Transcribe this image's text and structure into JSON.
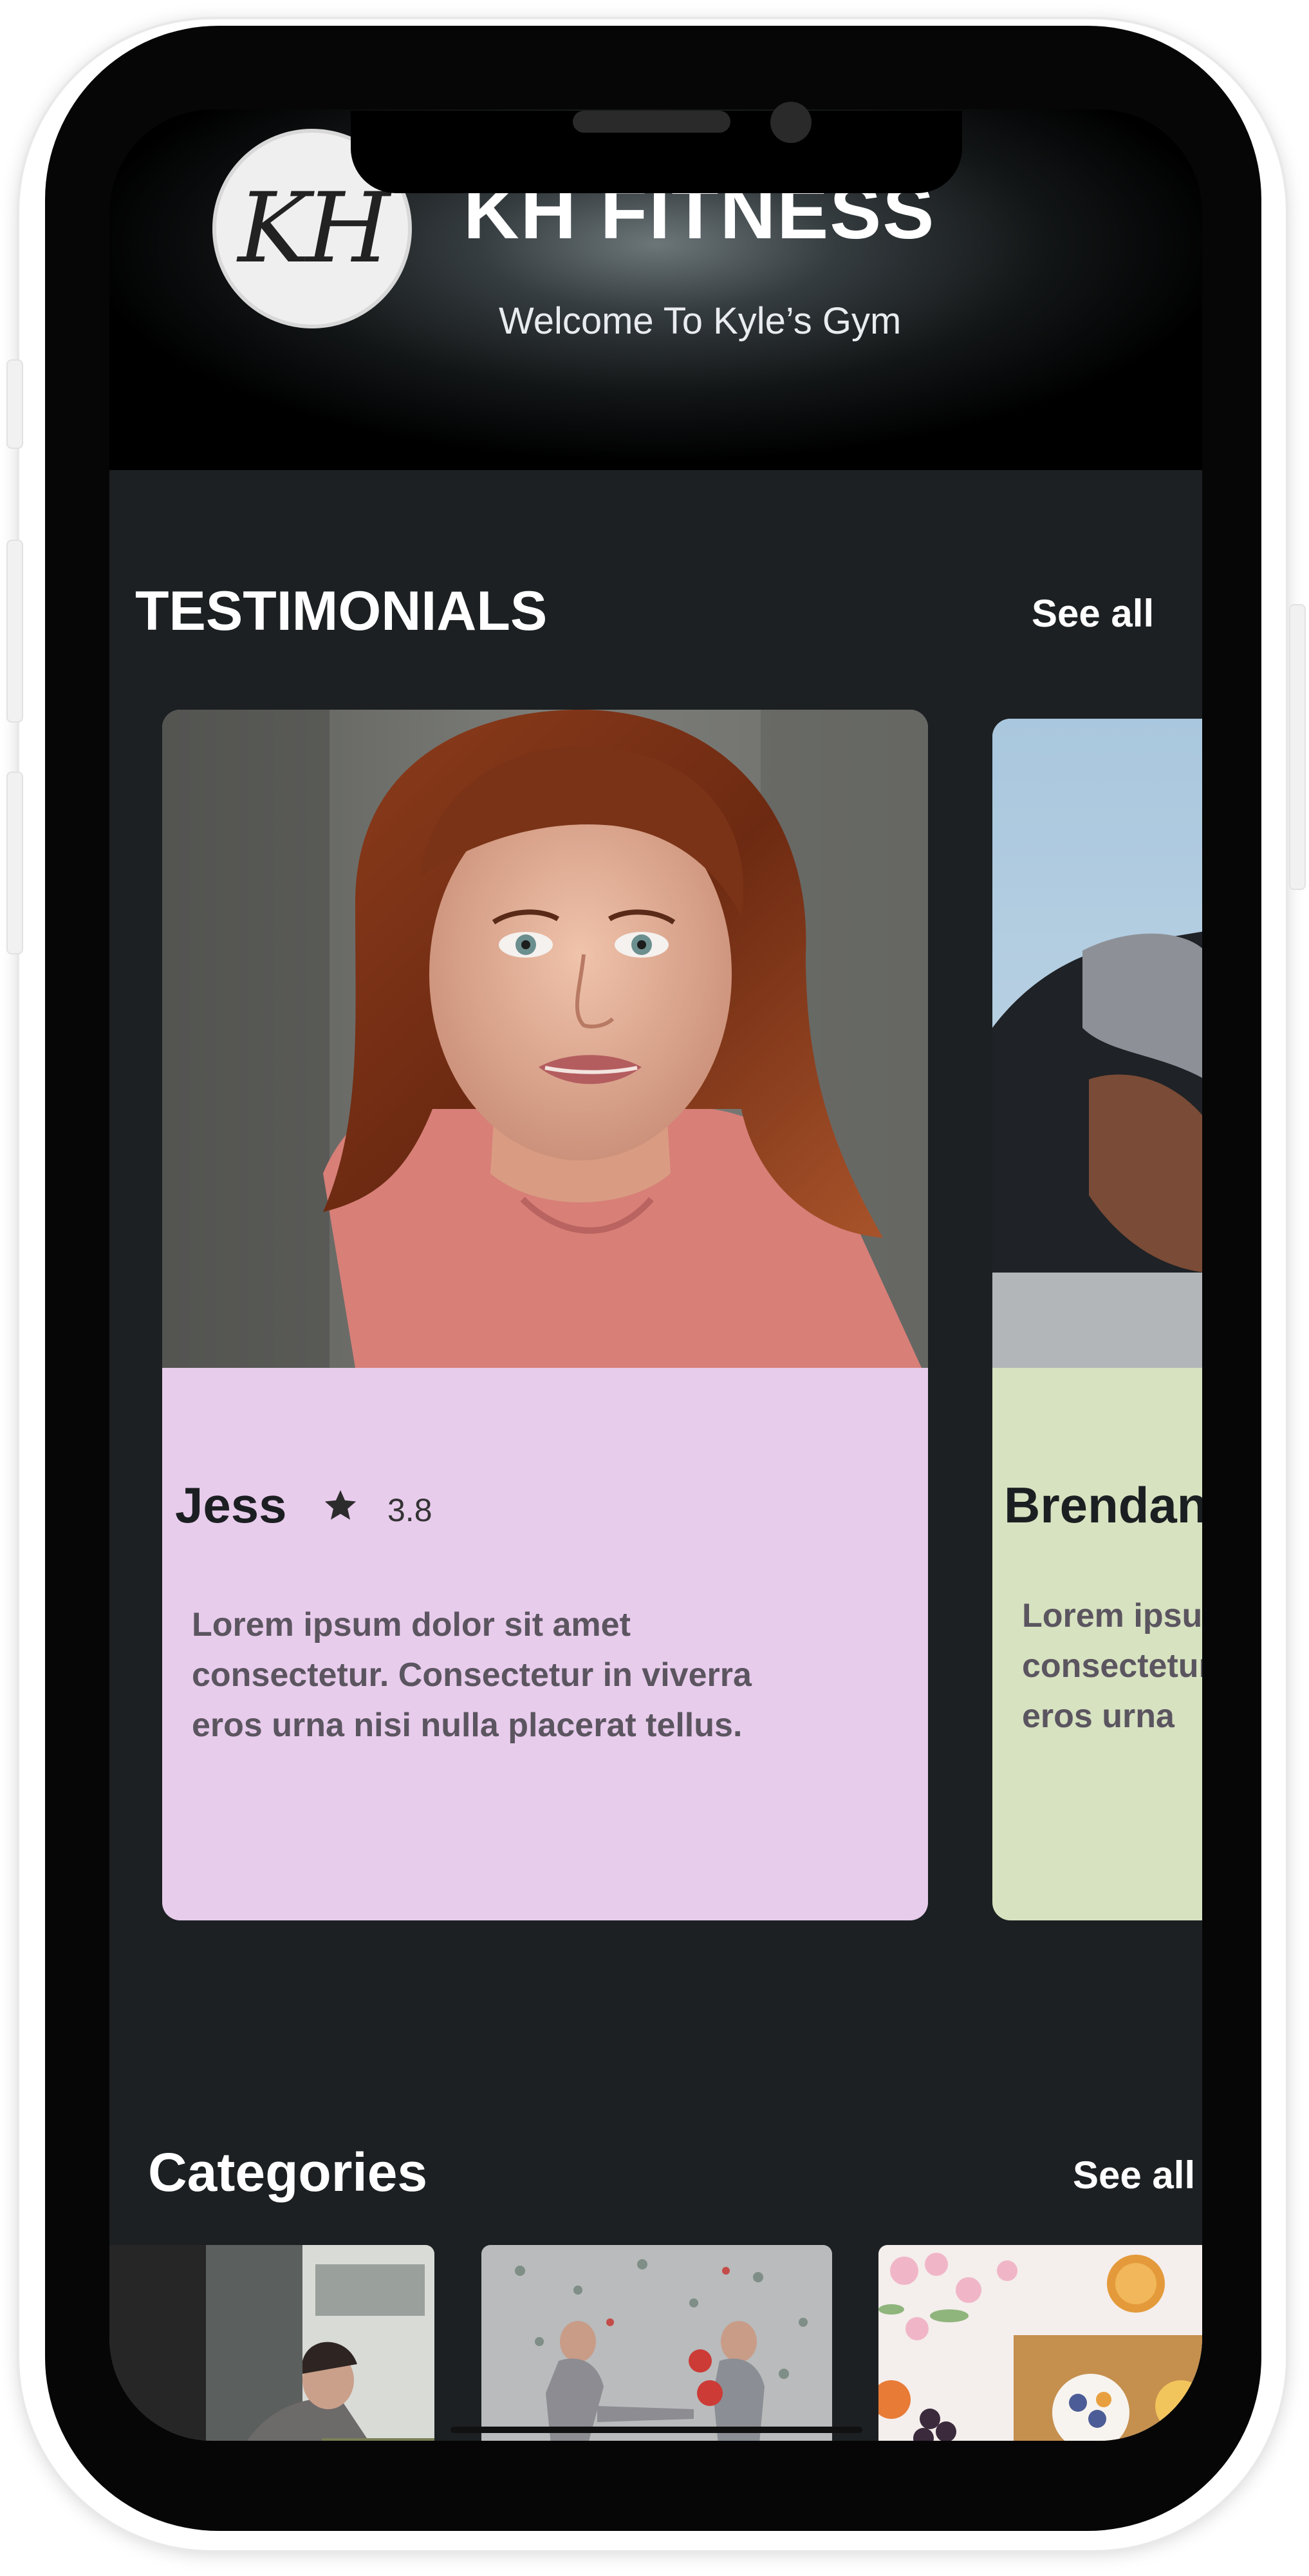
{
  "header": {
    "logo_text": "KH",
    "brand": "KH FITNESS",
    "welcome": "Welcome To Kyle’s Gym"
  },
  "testimonials": {
    "title": "TESTIMONIALS",
    "see_all": "See all",
    "cards": [
      {
        "name": "Jess",
        "rating": "3.8",
        "text_lines": [
          "Lorem ipsum dolor sit amet",
          "consectetur. Consectetur in viverra",
          "eros urna nisi nulla placerat tellus."
        ],
        "color": "#e8ccec"
      },
      {
        "name": "Brendan",
        "text_lines": [
          "Lorem ipsum",
          "consectetur",
          "eros urna"
        ],
        "color": "#d7e2c0"
      }
    ]
  },
  "categories": {
    "title": "Categories",
    "see_all": "See all"
  },
  "colors": {
    "screen_bg": "#1c2022",
    "card_pink": "#e8ccec",
    "card_green": "#d7e2c0"
  }
}
